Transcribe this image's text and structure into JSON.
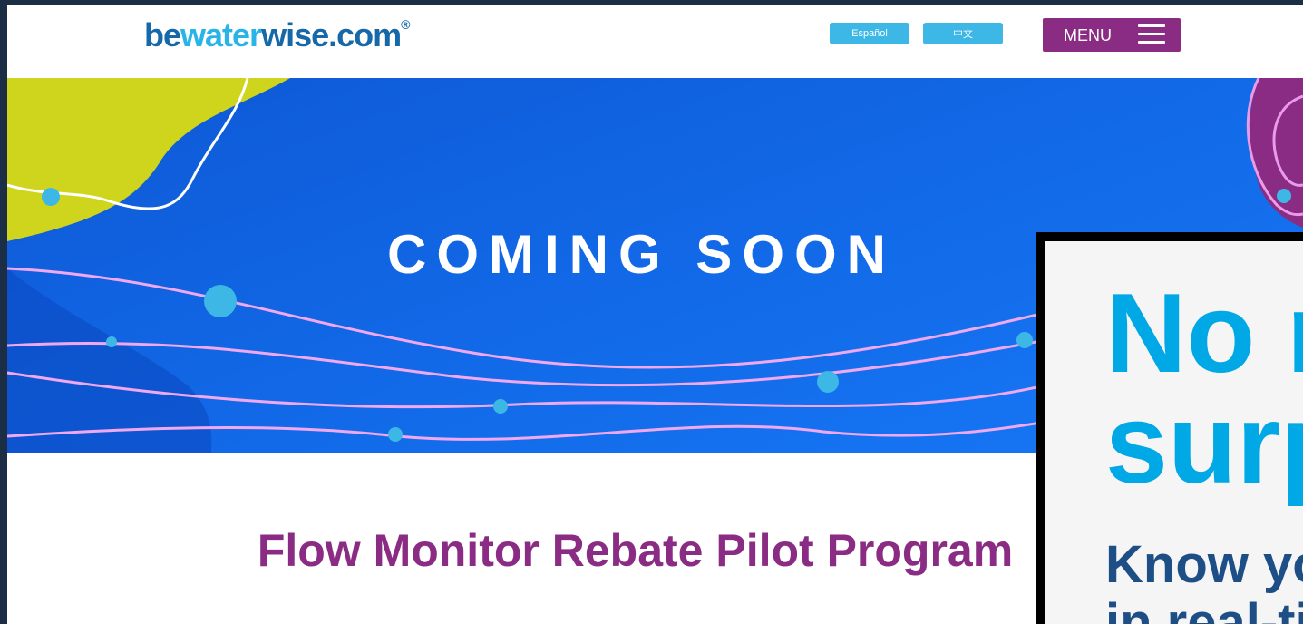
{
  "header": {
    "logo": {
      "part1": "be",
      "part2": "water",
      "part3": "wise.com",
      "mark": "®"
    },
    "languages": [
      {
        "label": "Español"
      },
      {
        "label": "中文"
      }
    ],
    "menu_label": "MENU"
  },
  "hero": {
    "title": "COMING SOON"
  },
  "main": {
    "program_title": "Flow Monitor Rebate Pilot Program"
  },
  "ad": {
    "line1": "No m",
    "line2": "surp",
    "line3": "Know you",
    "line4": "in real-ti"
  },
  "colors": {
    "brand_purple": "#8a2c83",
    "brand_blue": "#1668a8",
    "accent_cyan": "#3db7e6",
    "hero_blue": "#126ae8",
    "lime": "#cfd41c",
    "wave_pink": "#f0a8f0"
  },
  "icons": {
    "menu": "hamburger-icon"
  }
}
